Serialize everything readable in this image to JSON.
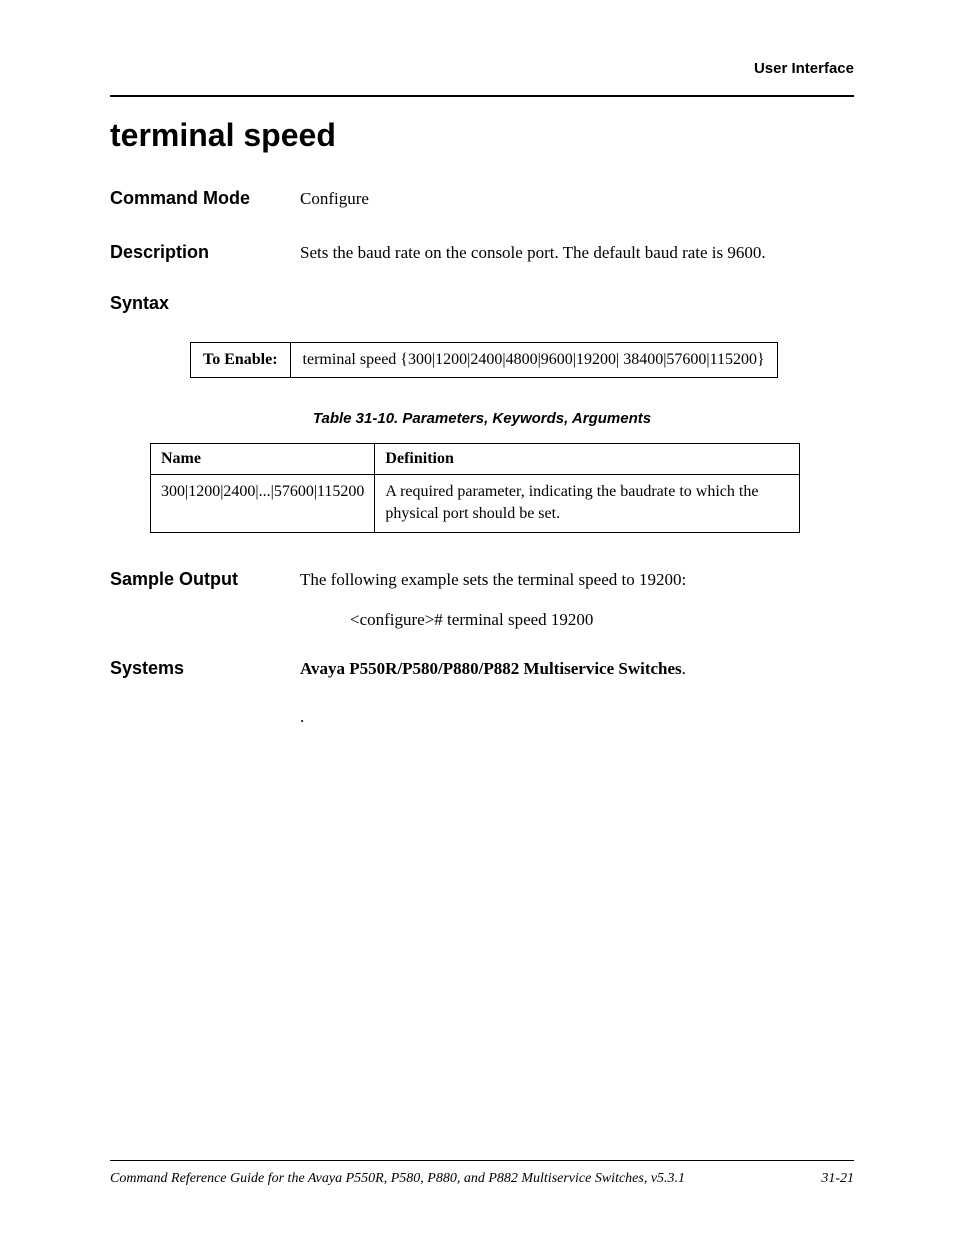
{
  "header": {
    "section_name": "User Interface"
  },
  "title": "terminal speed",
  "command_mode": {
    "label": "Command Mode",
    "value": "Configure"
  },
  "description": {
    "label": "Description",
    "value": "Sets the baud rate on the console port. The default baud rate is 9600."
  },
  "syntax": {
    "label": "Syntax",
    "enable_label": "To Enable:",
    "enable_value": "terminal speed {300|1200|2400|4800|9600|19200| 38400|57600|115200}"
  },
  "param_table": {
    "caption": "Table 31-10.  Parameters, Keywords, Arguments",
    "headers": {
      "name": "Name",
      "definition": "Definition"
    },
    "rows": [
      {
        "name": "300|1200|2400|...|57600|115200",
        "definition": "A required parameter, indicating the baudrate to which the physical port should be set."
      }
    ]
  },
  "sample_output": {
    "label": "Sample Output",
    "intro": "The following example sets the terminal speed to 19200:",
    "code": "<configure># terminal speed 19200"
  },
  "systems": {
    "label": "Systems",
    "value": "Avaya P550R/P580/P880/P882 Multiservice Switches",
    "period": "."
  },
  "trailing_dot": ".",
  "footer": {
    "text": "Command Reference Guide for the Avaya P550R, P580, P880, and P882 Multiservice Switches, v5.3.1",
    "page": "31-21"
  }
}
